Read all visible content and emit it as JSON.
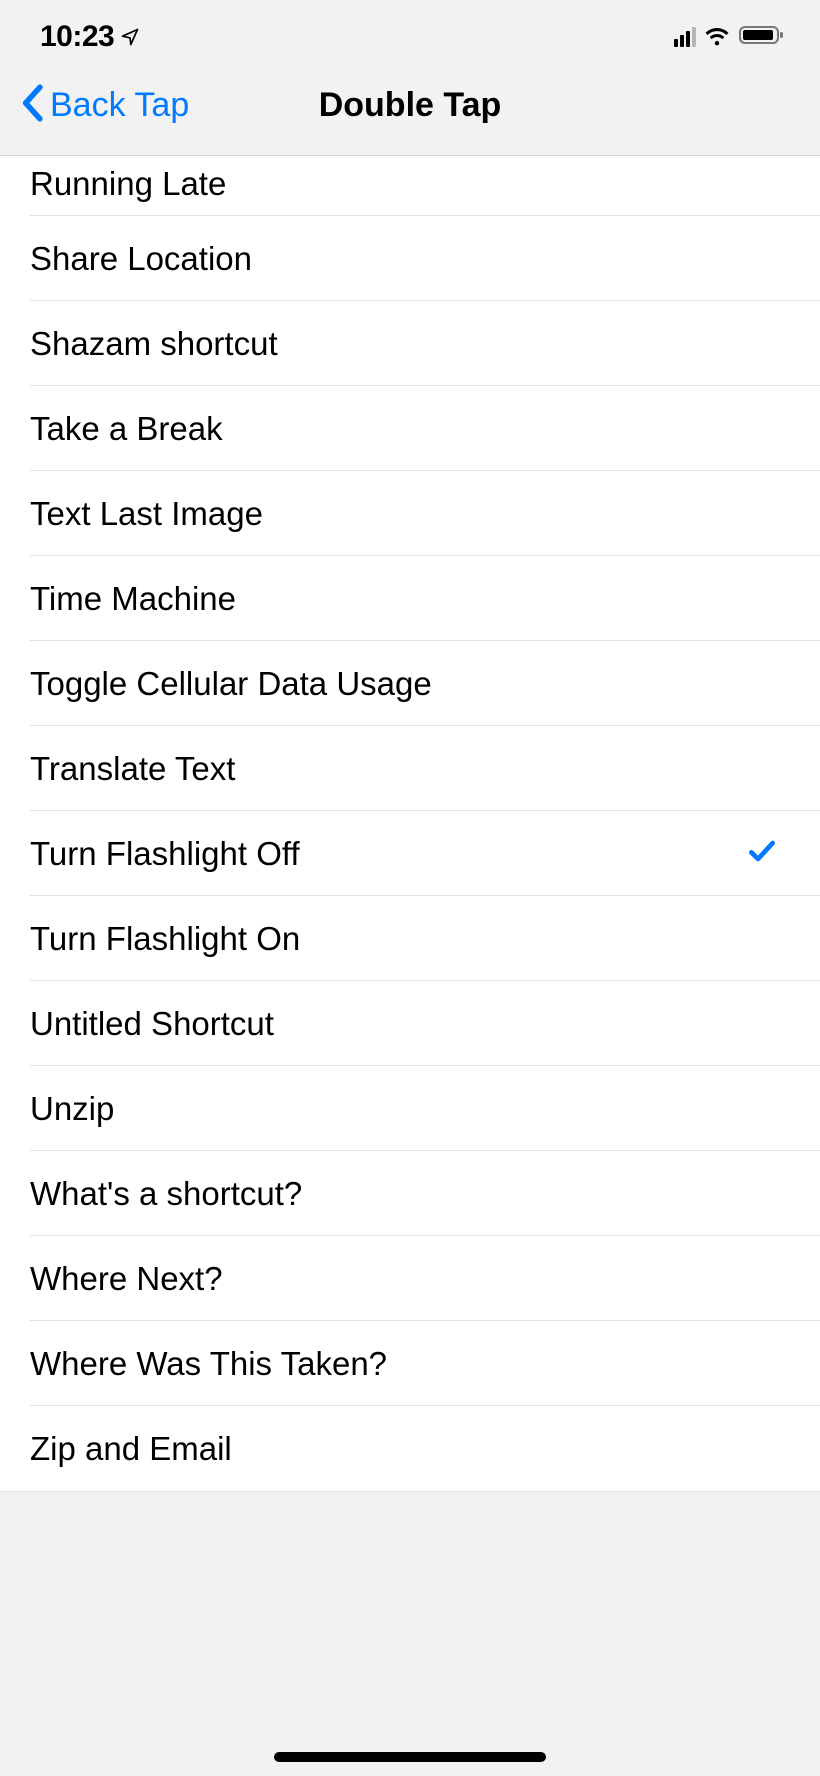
{
  "status": {
    "time": "10:23"
  },
  "nav": {
    "back_label": "Back Tap",
    "title": "Double Tap"
  },
  "list": {
    "items": [
      {
        "label": "Running Late",
        "selected": false
      },
      {
        "label": "Share Location",
        "selected": false
      },
      {
        "label": "Shazam shortcut",
        "selected": false
      },
      {
        "label": "Take a Break",
        "selected": false
      },
      {
        "label": "Text Last Image",
        "selected": false
      },
      {
        "label": "Time Machine",
        "selected": false
      },
      {
        "label": "Toggle Cellular Data Usage",
        "selected": false
      },
      {
        "label": "Translate Text",
        "selected": false
      },
      {
        "label": "Turn Flashlight Off",
        "selected": true
      },
      {
        "label": "Turn Flashlight On",
        "selected": false
      },
      {
        "label": "Untitled Shortcut",
        "selected": false
      },
      {
        "label": "Unzip",
        "selected": false
      },
      {
        "label": "What's a shortcut?",
        "selected": false
      },
      {
        "label": "Where Next?",
        "selected": false
      },
      {
        "label": "Where Was This Taken?",
        "selected": false
      },
      {
        "label": "Zip and Email",
        "selected": false
      }
    ]
  }
}
